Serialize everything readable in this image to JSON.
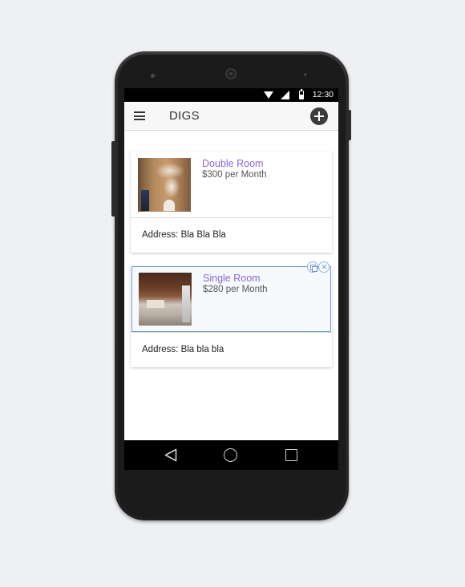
{
  "status_bar": {
    "time": "12:30"
  },
  "app_bar": {
    "title": "DIGS",
    "menu_icon": "hamburger-menu-icon",
    "add_icon": "plus-circle-icon"
  },
  "listings": [
    {
      "title": "Double Room",
      "price": "$300 per Month",
      "address": "Address: Bla Bla Bla"
    },
    {
      "title": "Single Room",
      "price": "$280 per Month",
      "address": "Address: Bla bla bla"
    }
  ],
  "nav_bar": {
    "icons": [
      "back-icon",
      "home-icon",
      "recent-apps-icon"
    ]
  },
  "colors": {
    "background": "#eff0f4",
    "title_accent": "#8a66d9",
    "selection_outline": "#6f93d6"
  }
}
